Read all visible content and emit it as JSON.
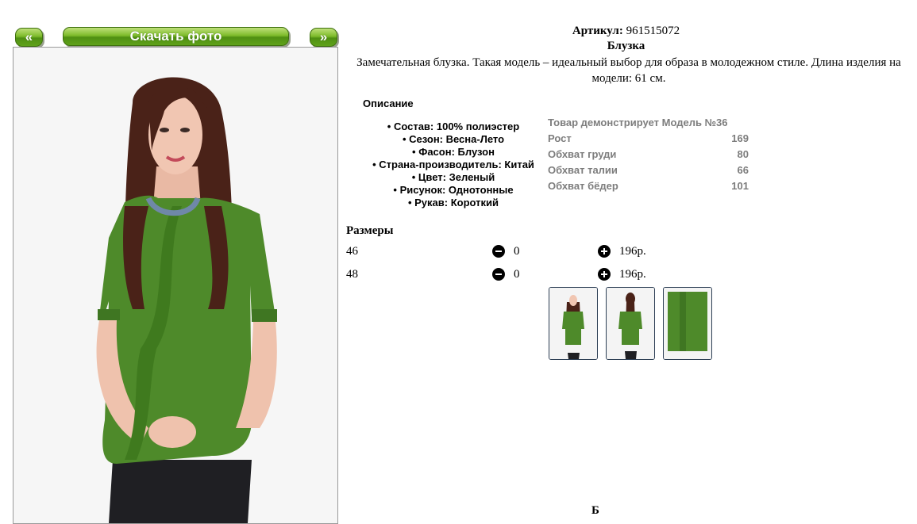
{
  "nav": {
    "prev_label": "«",
    "download_label": "Скачать фото",
    "next_label": "»"
  },
  "product": {
    "article_label": "Артикул:",
    "article_value": "961515072",
    "title": "Блузка",
    "description": "Замечательная блузка. Такая модель – идеальный выбор для образа в молодежном стиле. Длина изделия на модели: 61 см."
  },
  "description_section": {
    "heading": "Описание",
    "properties": [
      "Состав: 100% полиэстер",
      "Сезон: Весна-Лето",
      "Фасон: Блузон",
      "Страна-производитель: Китай",
      "Цвет: Зеленый",
      "Рисунок: Однотонные",
      "Рукав: Короткий"
    ]
  },
  "model_info": {
    "heading": "Товар демонстрирует Модель №36",
    "rows": [
      {
        "label": "Рост",
        "value": "169"
      },
      {
        "label": "Обхват груди",
        "value": "80"
      },
      {
        "label": "Обхват талии",
        "value": "66"
      },
      {
        "label": "Обхват бёдер",
        "value": "101"
      }
    ]
  },
  "sizes": {
    "heading": "Размеры",
    "rows": [
      {
        "size": "46",
        "qty": "0",
        "price": "196р."
      },
      {
        "size": "48",
        "qty": "0",
        "price": "196р."
      }
    ]
  },
  "thumbnails": [
    "front-view",
    "back-view",
    "fabric-detail"
  ],
  "footer_cut_text": "Б",
  "colors": {
    "button_green": "#5fa21a",
    "blouse_green": "#4e8a2a",
    "model_text_gray": "#7d7d7d"
  }
}
